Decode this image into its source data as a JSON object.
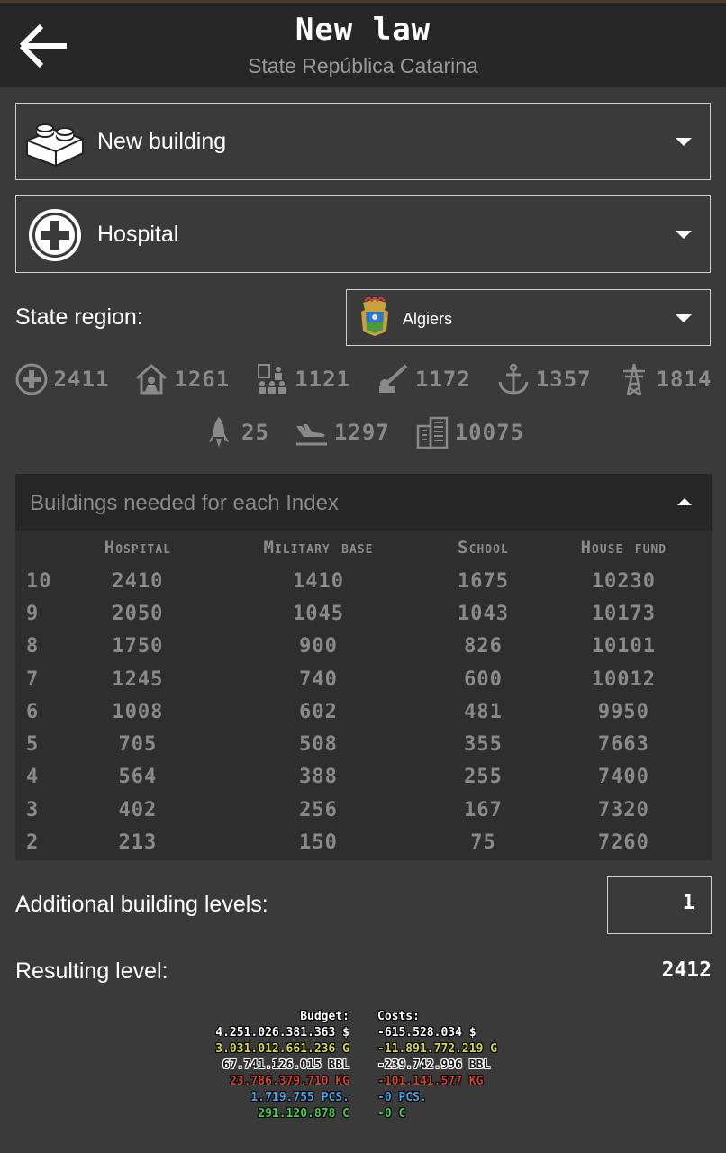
{
  "header": {
    "title": "New law",
    "subtitle": "State República Catarina",
    "back_icon": "arrow-left-icon"
  },
  "law_type": {
    "label": "New building",
    "icon": "lego-brick-icon"
  },
  "building": {
    "label": "Hospital",
    "icon": "plus-circle-icon"
  },
  "region": {
    "label": "State region:",
    "value": "Algiers",
    "icon": "algiers-coat-of-arms"
  },
  "stats": [
    {
      "icon": "hospital-plus-icon",
      "value": "2411"
    },
    {
      "icon": "house-person-icon",
      "value": "1261"
    },
    {
      "icon": "school-people-icon",
      "value": "1121"
    },
    {
      "icon": "artillery-icon",
      "value": "1172"
    },
    {
      "icon": "anchor-icon",
      "value": "1357"
    },
    {
      "icon": "power-tower-icon",
      "value": "1814"
    },
    {
      "icon": "rocket-icon",
      "value": "25"
    },
    {
      "icon": "plane-landing-icon",
      "value": "1297"
    },
    {
      "icon": "building-icon",
      "value": "10075"
    }
  ],
  "index_table": {
    "title": "Buildings needed for each Index",
    "headers": [
      "",
      "Hospital",
      "Military base",
      "School",
      "House fund"
    ],
    "rows": [
      [
        "10",
        "2410",
        "1410",
        "1675",
        "10230"
      ],
      [
        "9",
        "2050",
        "1045",
        "1043",
        "10173"
      ],
      [
        "8",
        "1750",
        "900",
        "826",
        "10101"
      ],
      [
        "7",
        "1245",
        "740",
        "600",
        "10012"
      ],
      [
        "6",
        "1008",
        "602",
        "481",
        "9950"
      ],
      [
        "5",
        "705",
        "508",
        "355",
        "7663"
      ],
      [
        "4",
        "564",
        "388",
        "255",
        "7400"
      ],
      [
        "3",
        "402",
        "256",
        "167",
        "7320"
      ],
      [
        "2",
        "213",
        "150",
        "75",
        "7260"
      ]
    ]
  },
  "additional_levels": {
    "label": "Additional building levels:",
    "value": "1"
  },
  "resulting_level": {
    "label": "Resulting level:",
    "value": "2412"
  },
  "budget": {
    "title": "Budget:",
    "lines": [
      {
        "text": "4.251.026.381.363 $",
        "color": "#ffffff"
      },
      {
        "text": "3.031.012.661.236 G",
        "color": "#d6d64a"
      },
      {
        "text": "67.741.126.015 BBL",
        "color": "#1a1a1a"
      },
      {
        "text": "23.786.379.710 KG",
        "color": "#d2452a"
      },
      {
        "text": "1.719.755 PCS.",
        "color": "#4aa3e8"
      },
      {
        "text": "291.120.878 C",
        "color": "#4ad04a"
      }
    ]
  },
  "costs": {
    "title": "Costs:",
    "lines": [
      {
        "text": "-615.528.034 $",
        "color": "#ffffff"
      },
      {
        "text": "-11.891.772.219 G",
        "color": "#d6d64a"
      },
      {
        "text": "-239.742.996 BBL",
        "color": "#1a1a1a"
      },
      {
        "text": "-101.141.577 KG",
        "color": "#d2452a"
      },
      {
        "text": "-0 PCS.",
        "color": "#4aa3e8"
      },
      {
        "text": "-0 C",
        "color": "#4ad04a"
      }
    ]
  }
}
